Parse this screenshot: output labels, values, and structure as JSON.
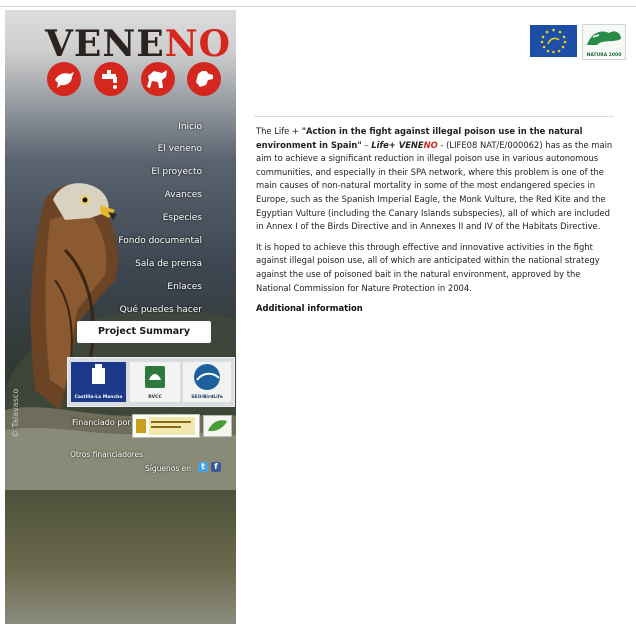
{
  "brand": {
    "part1": "VENE",
    "part2": "NO"
  },
  "menu": [
    {
      "label": "Inicio"
    },
    {
      "label": "El veneno"
    },
    {
      "label": "El proyecto"
    },
    {
      "label": "Avances"
    },
    {
      "label": "Especies"
    },
    {
      "label": "Fondo documental"
    },
    {
      "label": "Sala de prensa"
    },
    {
      "label": "Enlaces"
    },
    {
      "label": "Qué puedes hacer"
    }
  ],
  "project_summary": "Project Summary",
  "partners": [
    {
      "label": "Castilla-La Mancha"
    },
    {
      "label": "RVCC"
    },
    {
      "label": "SEO/BirdLife"
    }
  ],
  "financiado": "Financiado por",
  "otros": "Otros financiadores",
  "siguenos": "Síguenos en",
  "photo_credit": "© Talavasco",
  "logos": {
    "natura": "NATURA 2000"
  },
  "content": {
    "p1_a": "The Life + ",
    "p1_title": "\"Action in the fight against illegal poison use in the natural environment in Spain\"",
    "p1_dash": " – ",
    "p1_life": "Life+ VENE",
    "p1_no": "NO",
    "p1_code": " - (LIFE08 NAT/E/000062) has as the main aim to achieve a significant reduction in illegal poison use in various autonomous communities, and especially in their SPA network, where this problem is one of the main causes of non-natural mortality in some of the most endangered species in Europe, such as the Spanish Imperial Eagle, the Monk Vulture, the Red Kite and the Egyptian Vulture (including the Canary Islands subspecies), all of which are included in Annex I of the Birds Directive and in Annexes II and IV of the Habitats Directive.",
    "p2": "It is hoped to achieve this through effective and innovative activities in the fight against illegal poison use, all of which are anticipated within the national strategy against the use of poisoned bait in the natural environment, approved by the National Commission for Nature Protection in 2004.",
    "additional": "Additional information"
  },
  "colors": {
    "accent": "#d4281e",
    "dark": "#2a2320"
  }
}
